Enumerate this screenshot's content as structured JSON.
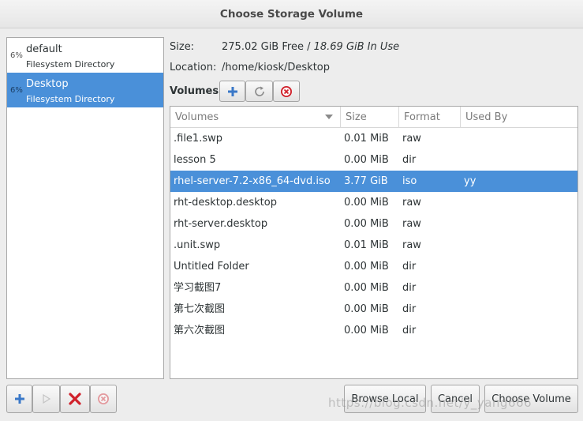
{
  "dialog": {
    "title": "Choose Storage Volume"
  },
  "pools": [
    {
      "percent": "6%",
      "name": "default",
      "type": "Filesystem Directory",
      "selected": false
    },
    {
      "percent": "6%",
      "name": "Desktop",
      "type": "Filesystem Directory",
      "selected": true
    }
  ],
  "info": {
    "size_label": "Size:",
    "size_free": "275.02 GiB Free / ",
    "size_in_use": "18.69 GiB In Use",
    "location_label": "Location:",
    "location_value": "/home/kiosk/Desktop"
  },
  "volumes_toolbar": {
    "label": "Volumes",
    "add_icon": "plus-icon",
    "refresh_icon": "refresh-icon",
    "delete_icon": "stop-icon"
  },
  "volume_table": {
    "columns": [
      "Volumes",
      "Size",
      "Format",
      "Used By"
    ],
    "sort_icon": "sort-down-icon",
    "rows": [
      {
        "name": ".file1.swp",
        "size": "0.01 MiB",
        "format": "raw",
        "used_by": ""
      },
      {
        "name": "lesson 5",
        "size": "0.00 MiB",
        "format": "dir",
        "used_by": ""
      },
      {
        "name": "rhel-server-7.2-x86_64-dvd.iso",
        "size": "3.77 GiB",
        "format": "iso",
        "used_by": "yy"
      },
      {
        "name": "rht-desktop.desktop",
        "size": "0.00 MiB",
        "format": "raw",
        "used_by": ""
      },
      {
        "name": "rht-server.desktop",
        "size": "0.00 MiB",
        "format": "raw",
        "used_by": ""
      },
      {
        "name": ".unit.swp",
        "size": "0.01 MiB",
        "format": "raw",
        "used_by": ""
      },
      {
        "name": "Untitled Folder",
        "size": "0.00 MiB",
        "format": "dir",
        "used_by": ""
      },
      {
        "name": "学习截图7",
        "size": "0.00 MiB",
        "format": "dir",
        "used_by": ""
      },
      {
        "name": "第七次截图",
        "size": "0.00 MiB",
        "format": "dir",
        "used_by": ""
      },
      {
        "name": "第六次截图",
        "size": "0.00 MiB",
        "format": "dir",
        "used_by": ""
      }
    ],
    "selected_index": 2
  },
  "pool_toolbar": {
    "add_icon": "plus-icon",
    "start_icon": "play-icon",
    "delete_icon": "delete-x-icon",
    "stop_icon": "stop-icon"
  },
  "footer": {
    "browse_local": "Browse Local",
    "cancel": "Cancel",
    "choose_volume": "Choose Volume",
    "watermark": "https://blog.csdn.net/y_yang666"
  },
  "colors": {
    "selection": "#4a90d9",
    "add_icon": "#3a78c8",
    "delete_red": "#d0202a"
  }
}
